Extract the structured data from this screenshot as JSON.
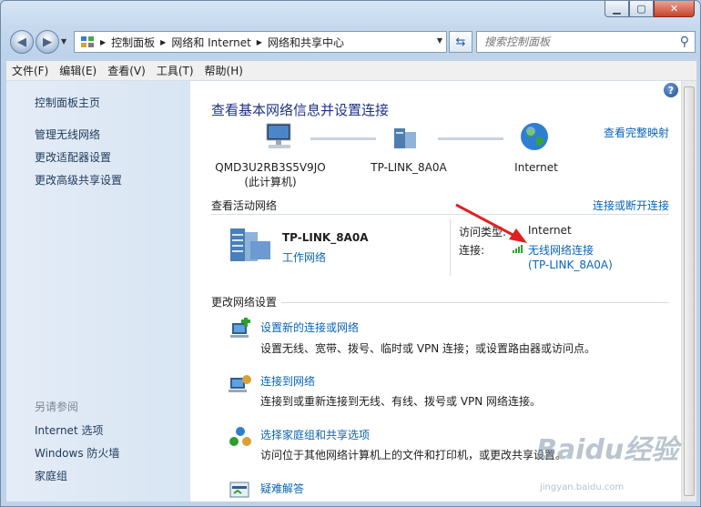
{
  "window": {
    "minimize_icon": "minimize-icon",
    "maximize_icon": "maximize-icon",
    "close_icon": "close-icon"
  },
  "address_bar": {
    "segments": [
      "控制面板",
      "网络和 Internet",
      "网络和共享中心"
    ]
  },
  "search": {
    "placeholder": "搜索控制面板"
  },
  "menu": {
    "items": [
      "文件(F)",
      "编辑(E)",
      "查看(V)",
      "工具(T)",
      "帮助(H)"
    ]
  },
  "sidebar": {
    "home": "控制面板主页",
    "links": [
      "管理无线网络",
      "更改适配器设置",
      "更改高级共享设置"
    ],
    "see_also_header": "另请参阅",
    "see_also": [
      "Internet 选项",
      "Windows 防火墙",
      "家庭组"
    ]
  },
  "main": {
    "title": "查看基本网络信息并设置连接",
    "map_link": "查看完整映射",
    "nodes": [
      {
        "name": "QMD3U2RB3S5V9JO",
        "sub": "(此计算机)"
      },
      {
        "name": "TP-LINK_8A0A",
        "sub": ""
      },
      {
        "name": "Internet",
        "sub": ""
      }
    ],
    "active_header": "查看活动网络",
    "connect_link": "连接或断开连接",
    "network": {
      "name": "TP-LINK_8A0A",
      "type": "工作网络",
      "access_label": "访问类型:",
      "access_value": "Internet",
      "conn_label": "连接:",
      "conn_value": "无线网络连接",
      "conn_sub": "(TP-LINK_8A0A)"
    },
    "change_header": "更改网络设置",
    "tasks": [
      {
        "title": "设置新的连接或网络",
        "desc": "设置无线、宽带、拨号、临时或 VPN 连接；或设置路由器或访问点。"
      },
      {
        "title": "连接到网络",
        "desc": "连接到或重新连接到无线、有线、拨号或 VPN 网络连接。"
      },
      {
        "title": "选择家庭组和共享选项",
        "desc": "访问位于其他网络计算机上的文件和打印机，或更改共享设置。"
      },
      {
        "title": "疑难解答",
        "desc": ""
      }
    ]
  },
  "watermark": {
    "logo": "Baidu经验",
    "url": "jingyan.baidu.com"
  },
  "colors": {
    "link": "#0b64b4",
    "title": "#1e3287",
    "arrow": "#e02020"
  }
}
